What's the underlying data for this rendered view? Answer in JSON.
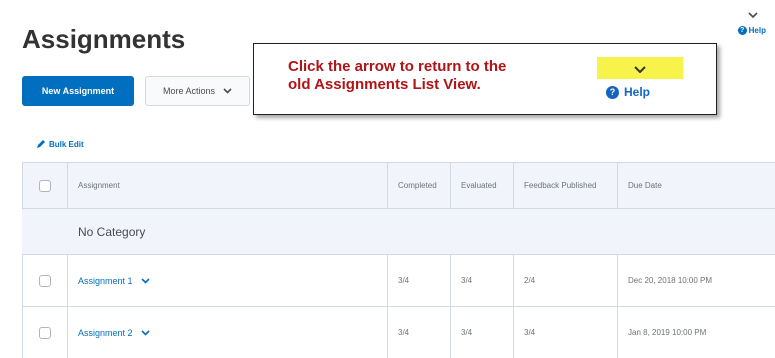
{
  "page": {
    "title": "Assignments"
  },
  "toolbar": {
    "new_label": "New Assignment",
    "more_label": "More Actions"
  },
  "bulk_edit": {
    "label": "Bulk Edit"
  },
  "top_help": {
    "label": "Help"
  },
  "tooltip": {
    "line1": "Click the arrow to return to the",
    "line2": "old Assignments List View.",
    "help_label": "Help",
    "highlight_color": "#f7f34a",
    "text_color": "#b01416"
  },
  "table": {
    "headers": {
      "assignment": "Assignment",
      "completed": "Completed",
      "evaluated": "Evaluated",
      "feedback": "Feedback Published",
      "due": "Due Date"
    },
    "category": "No Category",
    "rows": [
      {
        "name": "Assignment 1",
        "completed": "3/4",
        "evaluated": "3/4",
        "feedback": "2/4",
        "due": "Dec 20, 2018 10:00 PM"
      },
      {
        "name": "Assignment 2",
        "completed": "3/4",
        "evaluated": "3/4",
        "feedback": "3/4",
        "due": "Jan 8, 2019 10:00 PM"
      }
    ]
  },
  "colors": {
    "accent": "#006fbf",
    "header_bg": "#f1f5fb"
  }
}
